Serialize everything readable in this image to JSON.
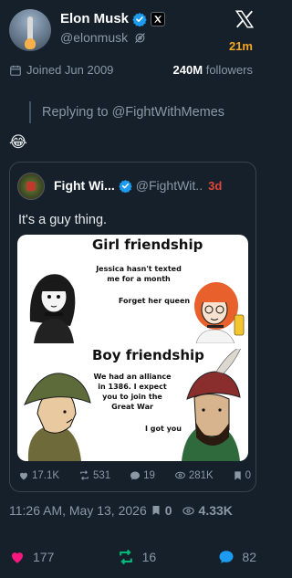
{
  "author": {
    "name": "Elon Musk",
    "handle": "@elonmusk",
    "time": "21m",
    "joined": "Joined Jun 2009",
    "followers_count": "240M",
    "followers_label": "followers"
  },
  "reply": {
    "text": "Replying to @FightWithMemes"
  },
  "tweet": {
    "emoji": "😂"
  },
  "quote": {
    "name": "Fight Wi...",
    "handle": "@FightWit..",
    "time": "3d",
    "text": "It's a guy thing.",
    "meme": {
      "top_title": "Girl friendship",
      "top_line1": "Jessica hasn't texted",
      "top_line2": "me for a month",
      "top_line3": "Forget her queen",
      "bottom_title": "Boy friendship",
      "bottom_line1": "We had an alliance",
      "bottom_line2": "in 1386. I expect",
      "bottom_line3": "you to join the",
      "bottom_line4": "Great War",
      "bottom_line5": "I got you"
    },
    "stats": {
      "likes": "17.1K",
      "reposts": "531",
      "replies": "19",
      "views": "281K",
      "bookmarks": "0"
    }
  },
  "footer": {
    "timestamp": "11:26 AM, May 13, 2026",
    "bookmarks": "0",
    "views": "4.33K"
  },
  "actions": {
    "likes": "177",
    "reposts": "16",
    "replies": "82"
  },
  "colors": {
    "background": "#15202b",
    "accent": "#1d9bf0",
    "like": "#f91880",
    "repost": "#00ba7c",
    "time_orange": "#f5a623"
  }
}
